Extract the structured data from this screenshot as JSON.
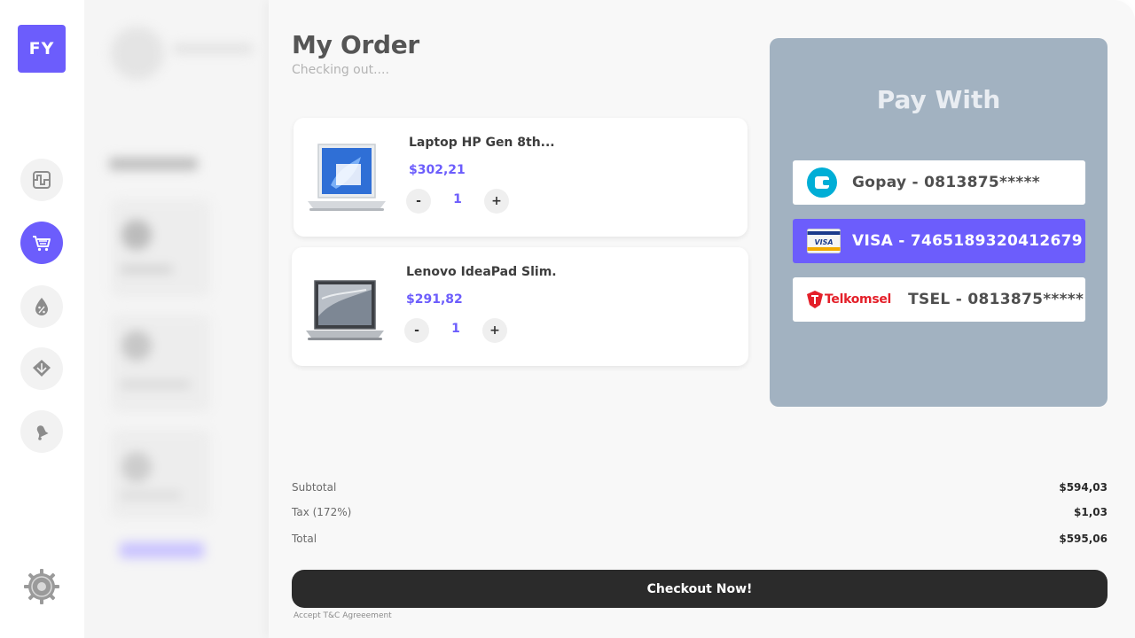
{
  "app": {
    "logo_text": "FY"
  },
  "nav": [
    {
      "name": "dashboard",
      "icon": "pulse-icon",
      "active": false
    },
    {
      "name": "cart",
      "icon": "cart-icon",
      "active": true
    },
    {
      "name": "discounts",
      "icon": "discount-drop-icon",
      "active": false
    },
    {
      "name": "products",
      "icon": "box-icon",
      "active": false
    },
    {
      "name": "notifications",
      "icon": "bell-icon",
      "active": false
    }
  ],
  "settings": {
    "icon": "gear-icon"
  },
  "order": {
    "title": "My Order",
    "subtitle": "Checking out....",
    "items": [
      {
        "name": "Laptop HP Gen 8th...",
        "price": "$302,21",
        "qty": "1",
        "minus": "-",
        "plus": "+"
      },
      {
        "name": "Lenovo IdeaPad Slim.",
        "price": "$291,82",
        "qty": "1",
        "minus": "-",
        "plus": "+"
      }
    ]
  },
  "pay": {
    "title": "Pay With",
    "options": [
      {
        "label": "Gopay - 0813875*****",
        "icon": "wallet-icon",
        "selected": false
      },
      {
        "label": "VISA - 7465189320412679",
        "icon": "visa-card-icon",
        "card_text": "VISA",
        "selected": true
      },
      {
        "label": "TSEL - 0813875*****",
        "icon": "telkomsel-logo",
        "brand_text": "Telkomsel",
        "selected": false
      }
    ]
  },
  "summary": {
    "subtotal_label": "Subtotal",
    "subtotal_value": "$594,03",
    "tax_label": "Tax (172%)",
    "tax_value": "$1,03",
    "total_label": "Total",
    "total_value": "$595,06"
  },
  "checkout": {
    "button_label": "Checkout Now!",
    "terms": "Accept T&C Agreeement"
  },
  "colors": {
    "accent": "#6c5dfc",
    "pay_panel": "#a2b2c1",
    "dark_button": "#2b2b2b",
    "gopay": "#00aed6",
    "telkomsel_red": "#e4202a"
  }
}
